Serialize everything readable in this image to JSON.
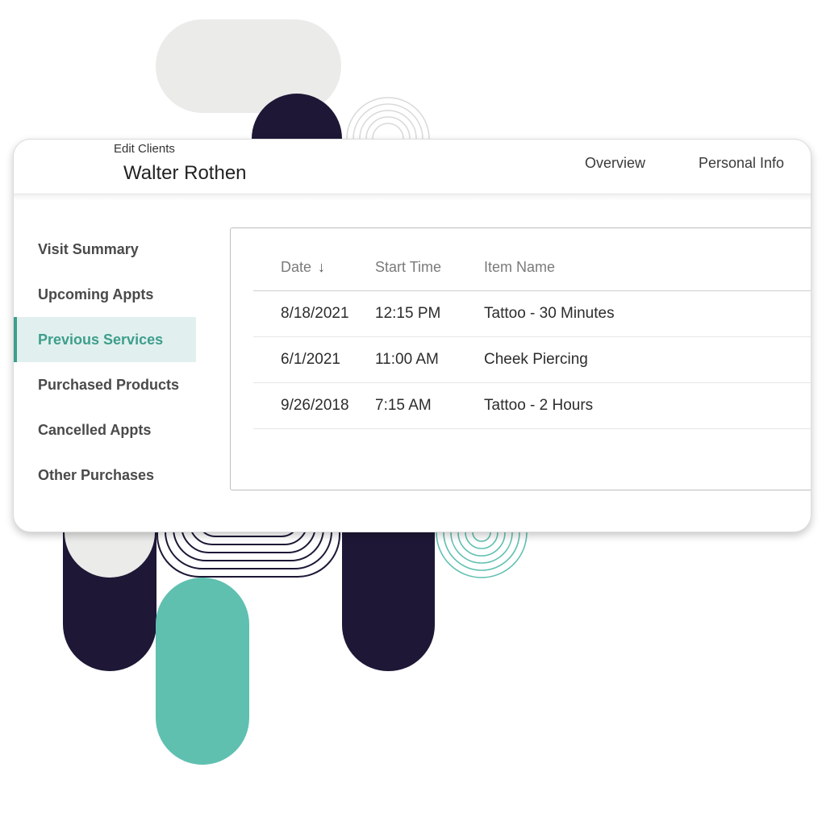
{
  "header": {
    "subtitle": "Edit Clients",
    "client_name": "Walter Rothen",
    "tabs": [
      {
        "label": "Overview"
      },
      {
        "label": "Personal Info"
      }
    ]
  },
  "sidebar": {
    "items": [
      {
        "label": "Visit Summary",
        "active": false
      },
      {
        "label": "Upcoming Appts",
        "active": false
      },
      {
        "label": "Previous Services",
        "active": true
      },
      {
        "label": "Purchased Products",
        "active": false
      },
      {
        "label": "Cancelled Appts",
        "active": false
      },
      {
        "label": "Other Purchases",
        "active": false
      }
    ]
  },
  "table": {
    "columns": [
      {
        "label": "Date",
        "sort": "descending",
        "sort_icon": "arrow-down-icon"
      },
      {
        "label": "Start Time"
      },
      {
        "label": "Item Name"
      }
    ],
    "rows": [
      {
        "date": "8/18/2021",
        "start_time": "12:15 PM",
        "item_name": "Tattoo - 30 Minutes"
      },
      {
        "date": "6/1/2021",
        "start_time": "11:00 AM",
        "item_name": "Cheek Piercing"
      },
      {
        "date": "9/26/2018",
        "start_time": "7:15 AM",
        "item_name": "Tattoo - 2 Hours"
      }
    ]
  },
  "colors": {
    "accent": "#3e9e8c",
    "accent_bg": "#e1f0ee",
    "navy": "#1e1736",
    "teal_shape": "#5fc0b0",
    "light_gray_shape": "#ebebea"
  }
}
